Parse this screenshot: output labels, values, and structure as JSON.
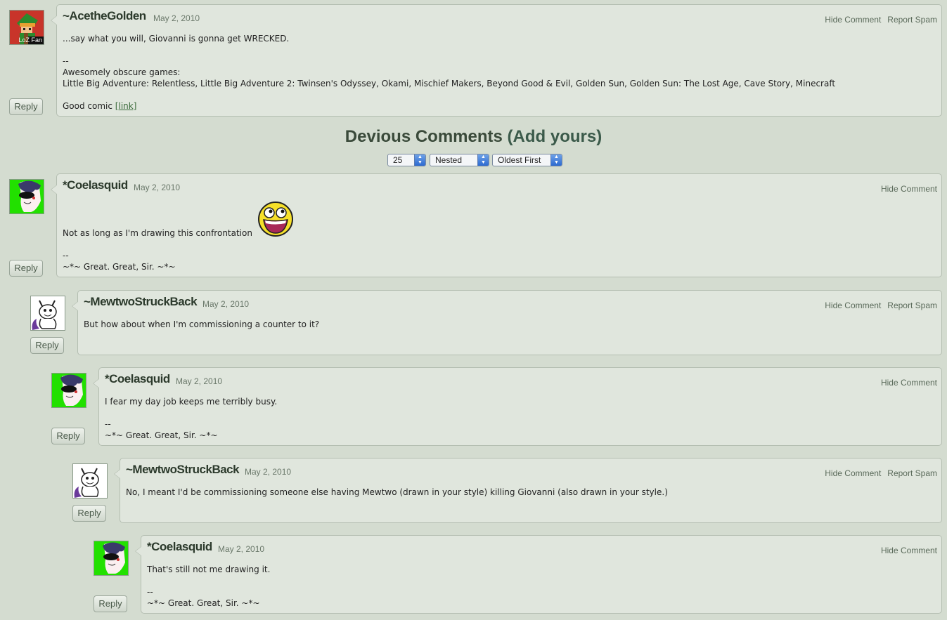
{
  "comments": [
    {
      "author": "~AcetheGolden",
      "date": "May 2, 2010",
      "actions": [
        "Hide Comment",
        "Report Spam"
      ],
      "body_main": "...say what you will, Giovanni is gonna get WRECKED.\n\n--\nAwesomely obscure games:\nLittle Big Adventure: Relentless, Little Big Adventure 2: Twinsen's Odyssey, Okami, Mischief Makers, Beyond Good & Evil, Golden Sun, Golden Sun: The Lost Age, Cave Story, Minecraft\n\nGood comic ",
      "link_text": "[link]",
      "avatar_label": "LoZ Fan",
      "reply": "Reply"
    },
    {
      "author": "*Coelasquid",
      "date": "May 2, 2010",
      "actions": [
        "Hide Comment"
      ],
      "body": "Not as long as I'm drawing this confrontation",
      "signature": "--\n~*~ Great. Great, Sir. ~*~",
      "reply": "Reply"
    },
    {
      "author": "~MewtwoStruckBack",
      "date": "May 2, 2010",
      "actions": [
        "Hide Comment",
        "Report Spam"
      ],
      "body": "But how about when I'm commissioning a counter to it?",
      "reply": "Reply"
    },
    {
      "author": "*Coelasquid",
      "date": "May 2, 2010",
      "actions": [
        "Hide Comment"
      ],
      "body": "I fear my day job keeps me terribly busy.\n\n--\n~*~ Great. Great, Sir. ~*~",
      "reply": "Reply"
    },
    {
      "author": "~MewtwoStruckBack",
      "date": "May 2, 2010",
      "actions": [
        "Hide Comment",
        "Report Spam"
      ],
      "body": "No, I meant I'd be commissioning someone else having Mewtwo (drawn in your style) killing Giovanni (also drawn in your style.)",
      "reply": "Reply"
    },
    {
      "author": "*Coelasquid",
      "date": "May 2, 2010",
      "actions": [
        "Hide Comment"
      ],
      "body": "That's still not me drawing it.\n\n--\n~*~ Great. Great, Sir. ~*~",
      "reply": "Reply"
    }
  ],
  "section": {
    "title": "Devious Comments",
    "add_link": "(Add yours)",
    "per_page": "25",
    "view_mode": "Nested",
    "sort_order": "Oldest First"
  },
  "colors": {
    "page_bg": "#d4dcd0",
    "box_bg": "#e0e6dd",
    "avatar_green": "#22e000"
  }
}
